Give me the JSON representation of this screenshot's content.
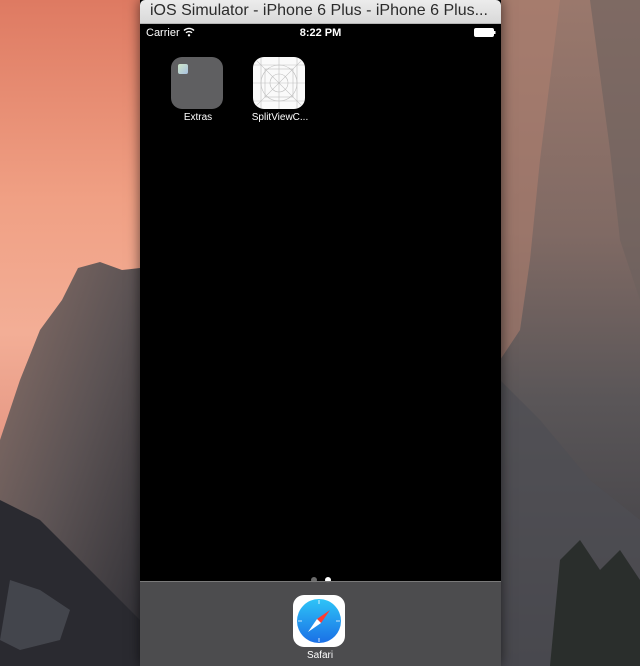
{
  "window": {
    "title": "iOS Simulator - iPhone 6 Plus - iPhone 6 Plus..."
  },
  "status_bar": {
    "carrier": "Carrier",
    "time": "8:22 PM",
    "wifi_icon": "wifi-icon",
    "battery_icon": "battery-full-icon"
  },
  "home_screen": {
    "apps": [
      {
        "label": "Extras",
        "icon": "folder-icon"
      },
      {
        "label": "SplitViewC...",
        "icon": "blank-app-icon"
      }
    ],
    "page_count": 2,
    "current_page": 2
  },
  "dock": {
    "apps": [
      {
        "label": "Safari",
        "icon": "safari-compass-icon"
      }
    ]
  },
  "colors": {
    "screen_background": "#000000",
    "dock_background": "#505052",
    "safari_blue": "#1e8ef0"
  }
}
